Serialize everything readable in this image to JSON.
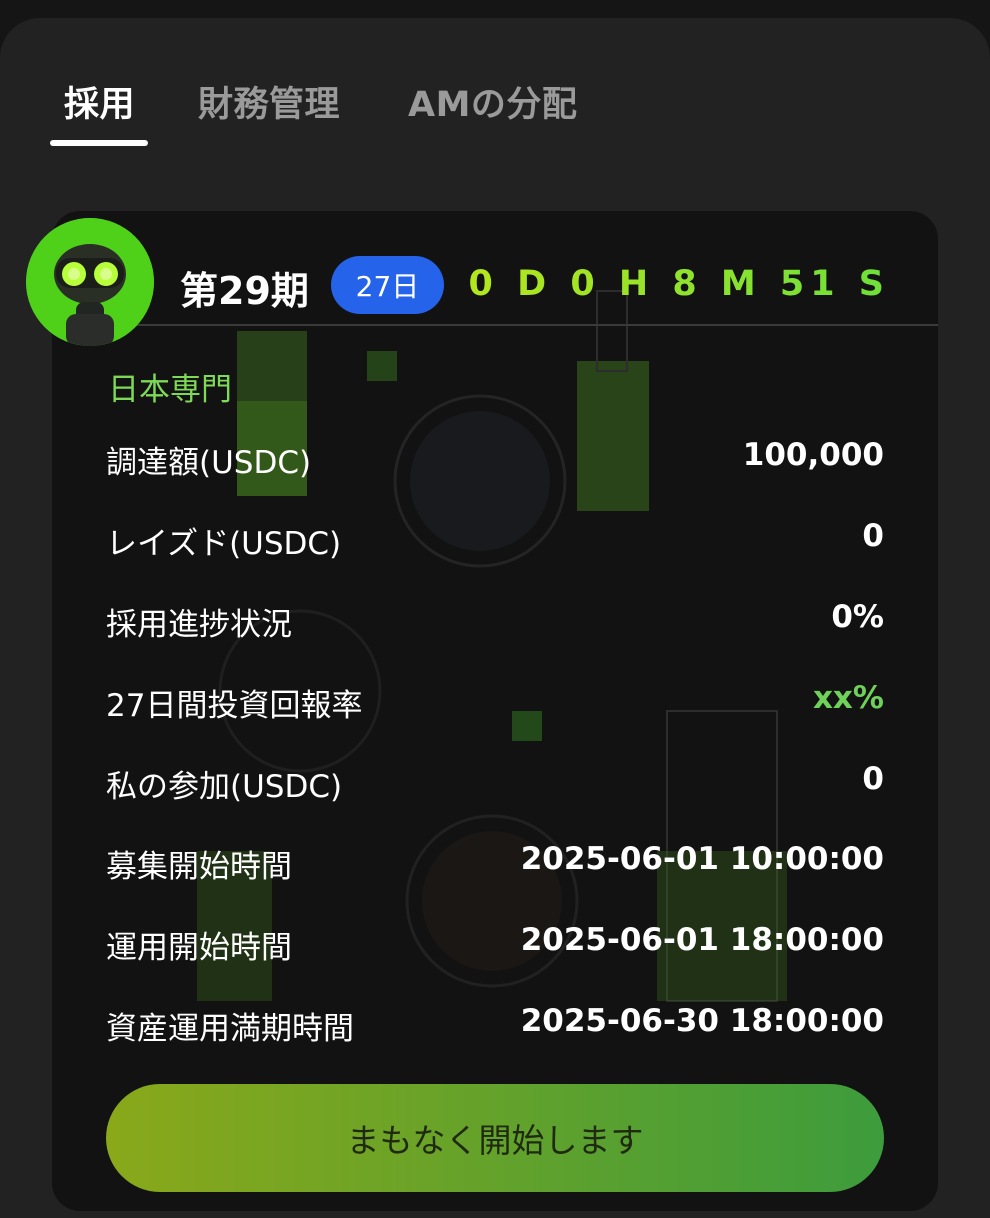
{
  "tabs": [
    {
      "label": "採用",
      "active": true
    },
    {
      "label": "財務管理",
      "active": false
    },
    {
      "label": "AMの分配",
      "active": false
    }
  ],
  "card": {
    "period_title": "第29期",
    "days_badge": "27日",
    "countdown": "0 D 0 H 8 M 51 S",
    "region": "日本専門",
    "rows": [
      {
        "label": "調達額(USDC)",
        "value": "100,000"
      },
      {
        "label": "レイズド(USDC)",
        "value": "0"
      },
      {
        "label": "採用進捗状況",
        "value": "0%"
      },
      {
        "label": "27日間投資回報率",
        "value": "xx%"
      },
      {
        "label": "私の参加(USDC)",
        "value": "0"
      },
      {
        "label": "募集開始時間",
        "value": "2025-06-01 10:00:00"
      },
      {
        "label": "運用開始時間",
        "value": "2025-06-01 18:00:00"
      },
      {
        "label": "資産運用満期時間",
        "value": "2025-06-30 18:00:00"
      }
    ],
    "cta_label": "まもなく開始します"
  },
  "colors": {
    "accent_green": "#7ed957",
    "badge_blue": "#2563ea",
    "roi_green": "#6fd05a"
  },
  "icons": {
    "avatar": "robot-avatar-icon"
  }
}
